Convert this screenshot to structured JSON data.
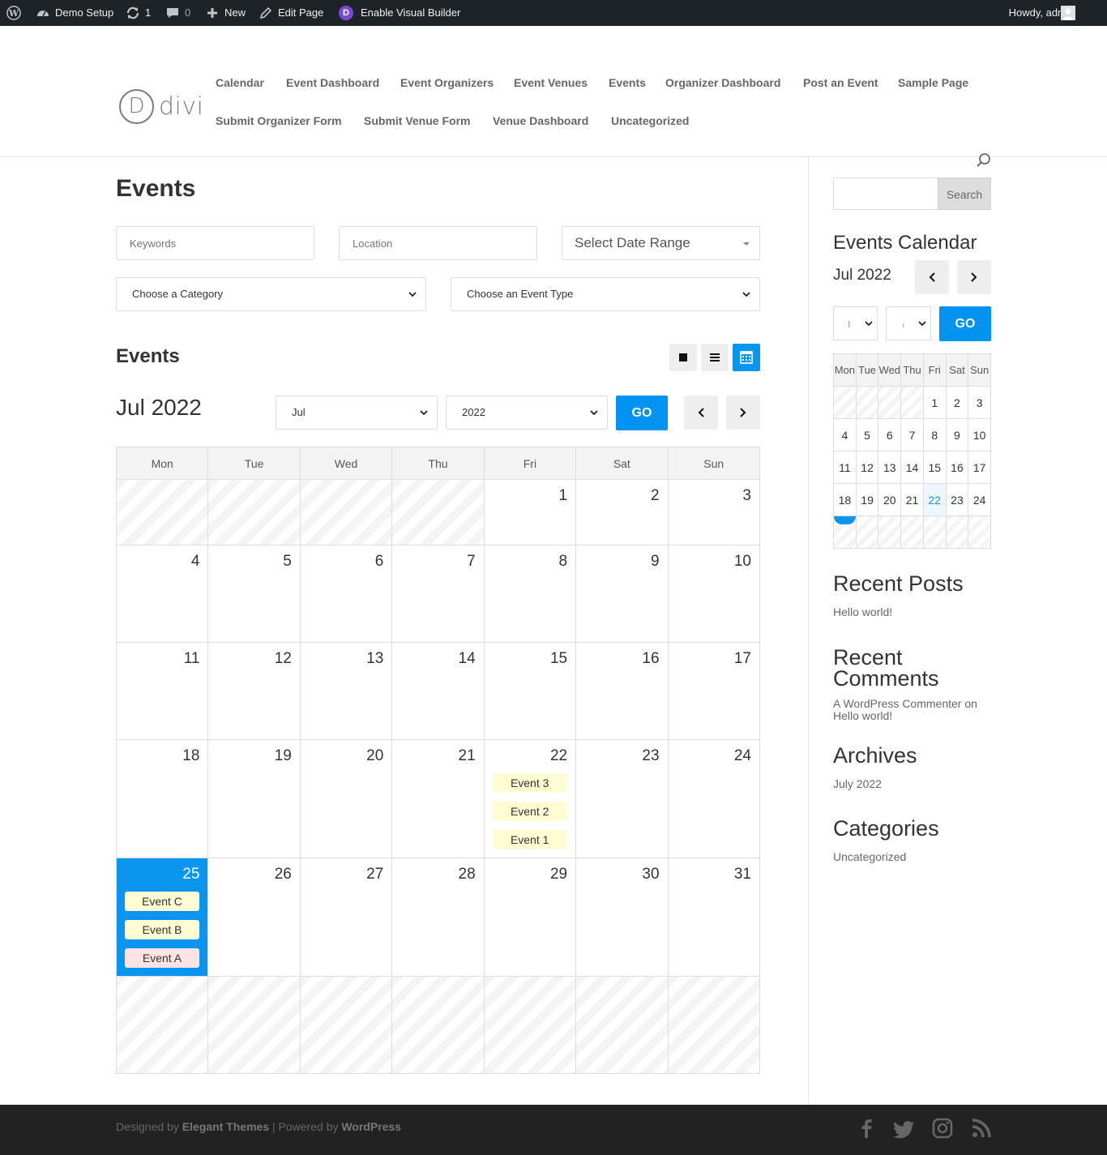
{
  "admin_bar": {
    "site_name": "Demo Setup",
    "updates_count": "1",
    "comments_count": "0",
    "new_label": "New",
    "edit_label": "Edit Page",
    "visual_builder_label": "Enable Visual Builder",
    "greeting": "Howdy, admin"
  },
  "header": {
    "logo_letter": "D",
    "logo_text": "divi",
    "nav": [
      "Calendar",
      "Event Dashboard",
      "Event Organizers",
      "Event Venues",
      "Events",
      "Organizer Dashboard",
      "Post an Event",
      "Sample Page",
      "Submit Organizer Form",
      "Submit Venue Form",
      "Venue Dashboard",
      "Uncategorized"
    ]
  },
  "main": {
    "title": "Events",
    "filters": {
      "keywords_placeholder": "Keywords",
      "location_placeholder": "Location",
      "date_range": "Select Date Range",
      "category": "Choose a Category",
      "event_type": "Choose an Event Type"
    },
    "section_title": "Events",
    "calendar": {
      "month_label": "Jul 2022",
      "month_select": "Jul",
      "year_select": "2022",
      "go_label": "GO",
      "weekdays": [
        "Mon",
        "Tue",
        "Wed",
        "Thu",
        "Fri",
        "Sat",
        "Sun"
      ],
      "weeks": [
        [
          "",
          "",
          "",
          "",
          "1",
          "2",
          "3"
        ],
        [
          "4",
          "5",
          "6",
          "7",
          "8",
          "9",
          "10"
        ],
        [
          "11",
          "12",
          "13",
          "14",
          "15",
          "16",
          "17"
        ],
        [
          "18",
          "19",
          "20",
          "21",
          "22",
          "23",
          "24"
        ],
        [
          "25",
          "26",
          "27",
          "28",
          "29",
          "30",
          "31"
        ],
        [
          "",
          "",
          "",
          "",
          "",
          "",
          ""
        ]
      ],
      "today": "25",
      "events_22": [
        "Event 3",
        "Event 2",
        "Event 1"
      ],
      "events_25": [
        "Event C",
        "Event B",
        "Event A"
      ]
    }
  },
  "sidebar": {
    "search_button": "Search",
    "events_calendar_title": "Events Calendar",
    "mini_month": "Jul 2022",
    "mini_go": "GO",
    "mini_weekdays": [
      "Mon",
      "Tue",
      "Wed",
      "Thu",
      "Fri",
      "Sat",
      "Sun"
    ],
    "mini_weeks": [
      [
        "",
        "",
        "",
        "",
        "1",
        "2",
        "3"
      ],
      [
        "4",
        "5",
        "6",
        "7",
        "8",
        "9",
        "10"
      ],
      [
        "11",
        "12",
        "13",
        "14",
        "15",
        "16",
        "17"
      ],
      [
        "18",
        "19",
        "20",
        "21",
        "22",
        "23",
        "24"
      ],
      [
        "",
        "",
        "",
        "",
        "",
        "",
        ""
      ]
    ],
    "recent_posts_title": "Recent Posts",
    "recent_post": "Hello world!",
    "recent_comments_title_1": "Recent",
    "recent_comments_title_2": "Comments",
    "comment_line_1": "A WordPress Commenter on",
    "comment_line_2": "Hello world!",
    "archives_title": "Archives",
    "archive_item": "July 2022",
    "categories_title": "Categories",
    "category_item": "Uncategorized"
  },
  "footer": {
    "designed_by": "Designed by ",
    "elegant": "Elegant Themes",
    "separator": " | Powered by ",
    "wordpress": "WordPress"
  },
  "colors": {
    "accent": "#0a96ee",
    "event_bg": "#fffbd2",
    "event_pink": "#fde3e3"
  }
}
